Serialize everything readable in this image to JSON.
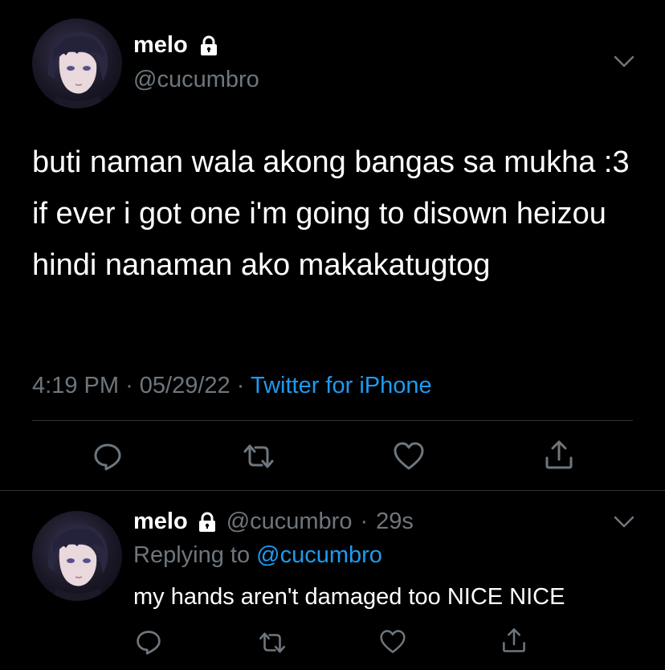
{
  "main_tweet": {
    "author_name": "melo",
    "author_handle": "@cucumbro",
    "text": "buti naman wala akong bangas sa mukha :3 if ever i got one i'm going to disown heizou hindi nanaman ako makakatugtog",
    "time": "4:19 PM",
    "separator": "·",
    "date": "05/29/22",
    "source": "Twitter for iPhone",
    "icons": [
      "lock-icon",
      "chevron-down-icon",
      "reply-icon",
      "retweet-icon",
      "like-icon",
      "share-icon"
    ]
  },
  "reply_tweet": {
    "author_name": "melo",
    "author_handle": "@cucumbro",
    "separator": "·",
    "age": "29s",
    "replying_prefix": "Replying to",
    "replying_to": "@cucumbro",
    "text": "my hands aren't damaged too NICE NICE",
    "icons": [
      "lock-icon",
      "chevron-down-icon",
      "reply-icon",
      "retweet-icon",
      "like-icon",
      "share-icon"
    ]
  },
  "colors": {
    "background": "#000000",
    "text_primary": "#ffffff",
    "text_secondary": "#6e767d",
    "link": "#1d9bf0",
    "divider": "#2f3336"
  }
}
